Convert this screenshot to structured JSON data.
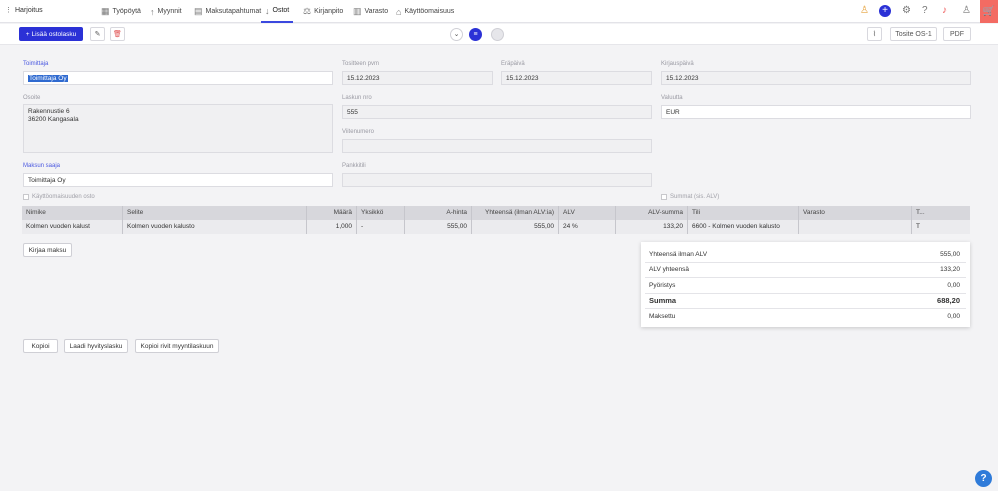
{
  "company": "Harjoitus",
  "nav": [
    {
      "icon": "dashboard-icon",
      "glyph": "▦",
      "label": "Työpöytä"
    },
    {
      "icon": "arrow-up-icon",
      "glyph": "↑",
      "label": "Myynnit"
    },
    {
      "icon": "payment-events-icon",
      "glyph": "▤",
      "label": "Maksutapahtumat"
    },
    {
      "icon": "arrow-down-icon",
      "glyph": "↓",
      "label": "Ostot"
    },
    {
      "icon": "accounting-icon",
      "glyph": "⚖",
      "label": "Kirjanpito"
    },
    {
      "icon": "warehouse-icon",
      "glyph": "▥",
      "label": "Varasto"
    },
    {
      "icon": "fixed-assets-icon",
      "glyph": "⌂",
      "label": "Käyttöomaisuus"
    }
  ],
  "toolbar": {
    "add_label": "Lisää ostolasku",
    "voucher_label": "Tosite OS-1",
    "pdf_label": "PDF"
  },
  "form": {
    "supplier_label": "Toimittaja",
    "supplier_value": "Toimittaja Oy",
    "document_date_label": "Tositteen pvm",
    "document_date_value": "15.12.2023",
    "due_date_label": "Eräpäivä",
    "due_date_value": "15.12.2023",
    "booking_date_label": "Kirjauspäivä",
    "booking_date_value": "15.12.2023",
    "address_label": "Osoite",
    "address_line1": "Rakennustie 6",
    "address_line2": "36200 Kangasala",
    "invoice_no_label": "Laskun nro",
    "invoice_no_value": "555",
    "currency_label": "Valuutta",
    "currency_value": "EUR",
    "reference_label": "Viitenumero",
    "reference_value": "",
    "payee_label": "Maksun saaja",
    "payee_value": "Toimittaja Oy",
    "bank_account_label": "Pankkitili",
    "bank_account_value": "",
    "fixed_asset_purchase_label": "Käyttöomaisuuden osto",
    "sums_incl_vat_label": "Summat (sis. ALV)"
  },
  "table": {
    "headers": [
      "Nimike",
      "Selite",
      "Määrä",
      "Yksikkö",
      "A-hinta",
      "Yhteensä (ilman ALV:ia)",
      "ALV",
      "ALV-summa",
      "Tili",
      "Varasto",
      "T..."
    ],
    "rows": [
      [
        "Kolmen vuoden kalust",
        "Kolmen vuoden kalusto",
        "1,000",
        "-",
        "555,00",
        "555,00",
        "24 %",
        "133,20",
        "6600 - Kolmen vuoden kalusto",
        "",
        "T"
      ]
    ]
  },
  "record_payment_label": "Kirjaa maksu",
  "summary": {
    "net_label": "Yhteensä ilman ALV",
    "net_value": "555,00",
    "vat_label": "ALV yhteensä",
    "vat_value": "133,20",
    "rounding_label": "Pyöristys",
    "rounding_value": "0,00",
    "total_label": "Summa",
    "total_value": "688,20",
    "paid_label": "Maksettu",
    "paid_value": "0,00"
  },
  "actions": {
    "copy": "Kopioi",
    "credit_note": "Laadi hyvityslasku",
    "copy_rows": "Kopioi rivit myyntilaskuun"
  },
  "colors": {
    "accent": "#2b31d6",
    "cart": "#f36b63",
    "help": "#2f7bd9"
  }
}
